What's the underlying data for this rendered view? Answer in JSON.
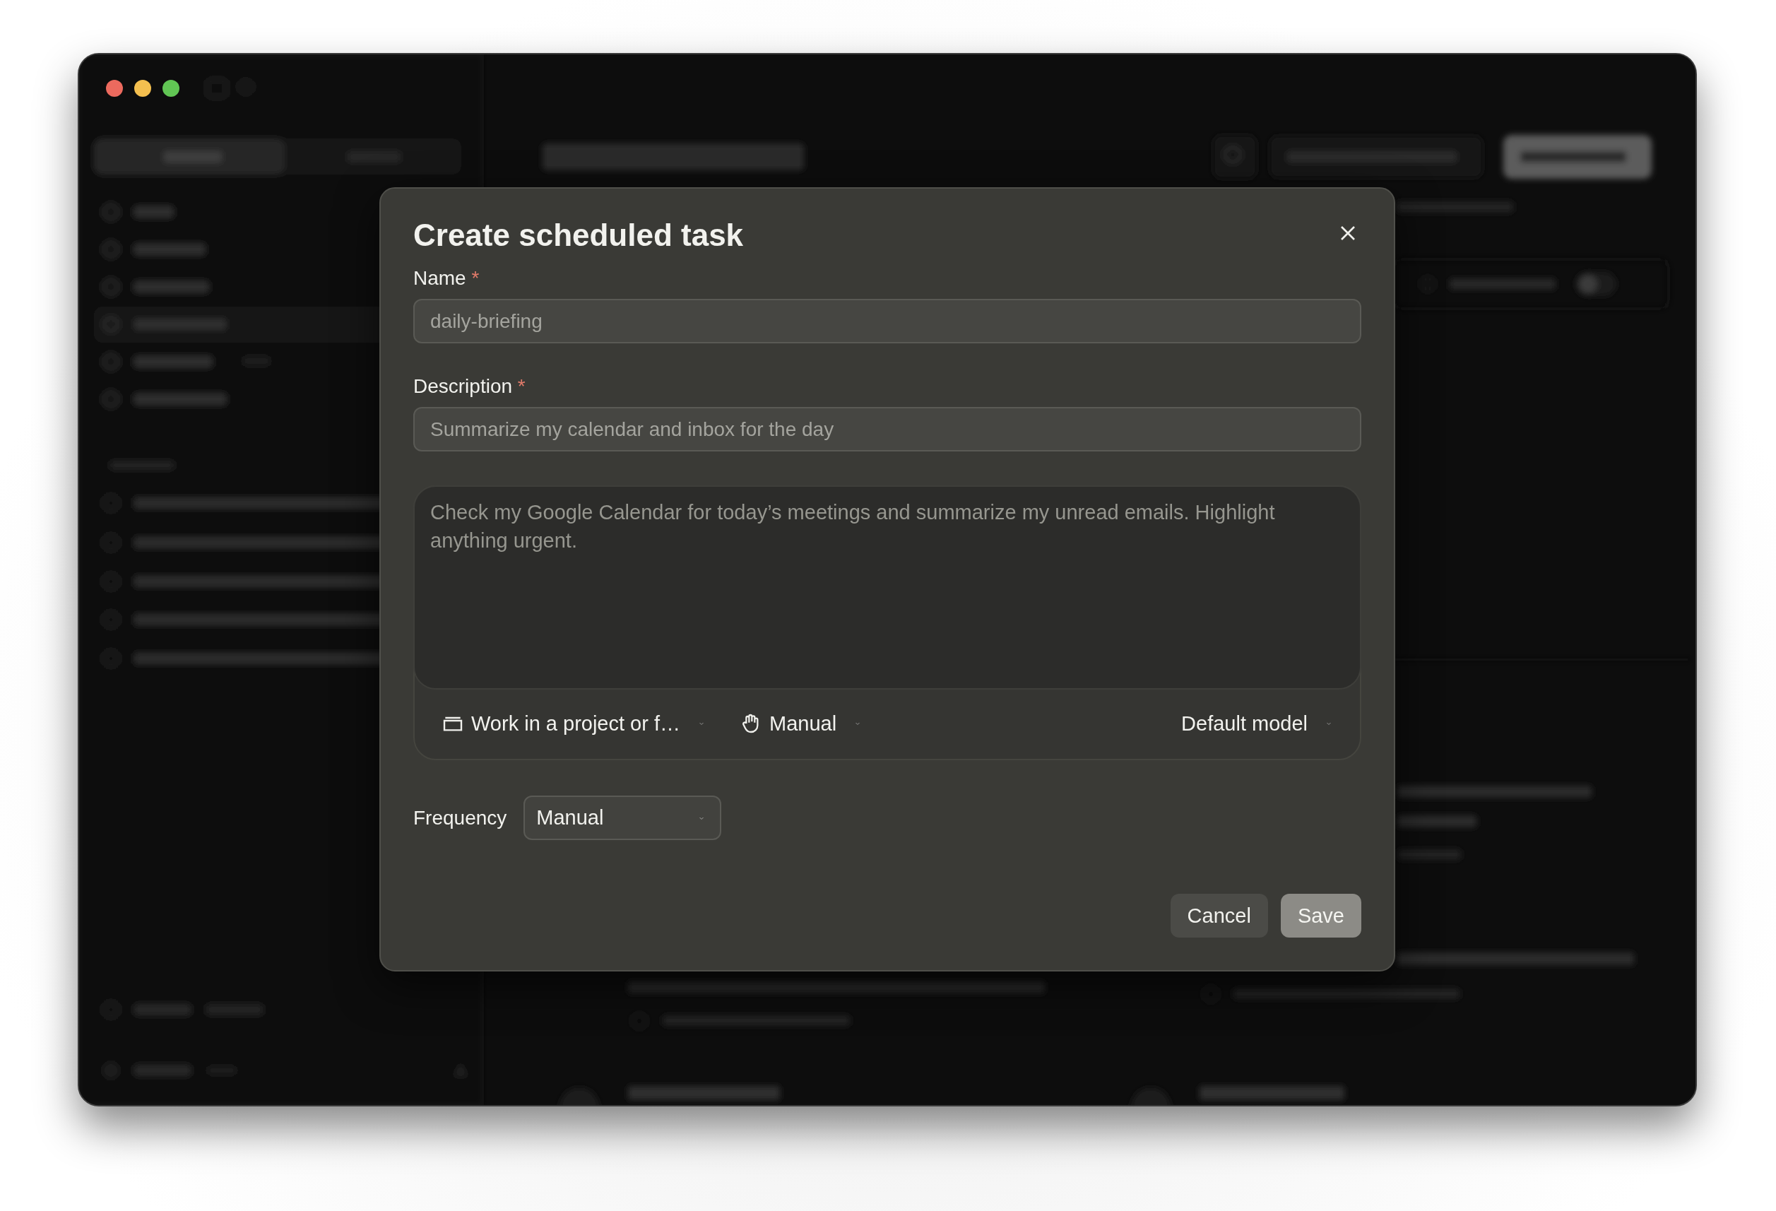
{
  "dialog": {
    "title": "Create scheduled task",
    "fields": [
      {
        "label": "Name",
        "required_mark": "*",
        "placeholder": "daily-briefing"
      },
      {
        "label": "Description",
        "required_mark": "*",
        "placeholder": "Summarize my calendar and inbox for the day"
      }
    ],
    "prompt": {
      "placeholder": "Check my Google Calendar for today’s meetings and summarize my unread emails. Highlight anything urgent.",
      "folder": "Work in a project or f…",
      "mode": "Manual",
      "model": "Default model"
    },
    "frequency": {
      "label": "Frequency",
      "value": "Manual"
    },
    "buttons": [
      {
        "label": "Cancel",
        "kind": "secondary"
      },
      {
        "label": "Save",
        "kind": "primary"
      }
    ]
  }
}
